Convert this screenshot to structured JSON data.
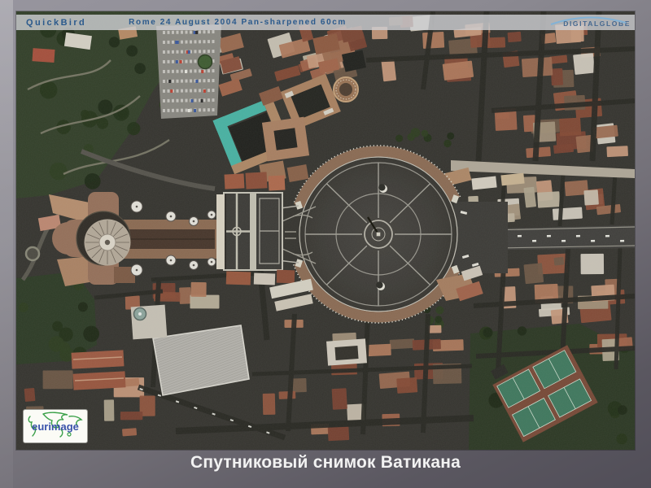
{
  "slide": {
    "caption": "Спутниковый снимок Ватикана"
  },
  "overlay": {
    "header": {
      "sensor": "QuickBird",
      "details": "Rome 24 August 2004 Pan-sharpened 60cm"
    },
    "digitalglobe": {
      "label": "DIGITALGLOBE"
    },
    "eurimage": {
      "label": "eurimage"
    }
  },
  "colors": {
    "header_text": "#2b5a8c",
    "digitalglobe_text": "#46688f",
    "digitalglobe_swoosh": "#82b2d6",
    "eurimage_text": "#3952aa",
    "eurimage_green": "#3aa048",
    "caption_text": "#f2f2f2",
    "roof_red": "#96573f",
    "piazza_asphalt": "#3e3d38",
    "colonnade_tan": "#8d6c54",
    "garden_green": "#313f28",
    "teal_roof": "#48b6a6"
  }
}
